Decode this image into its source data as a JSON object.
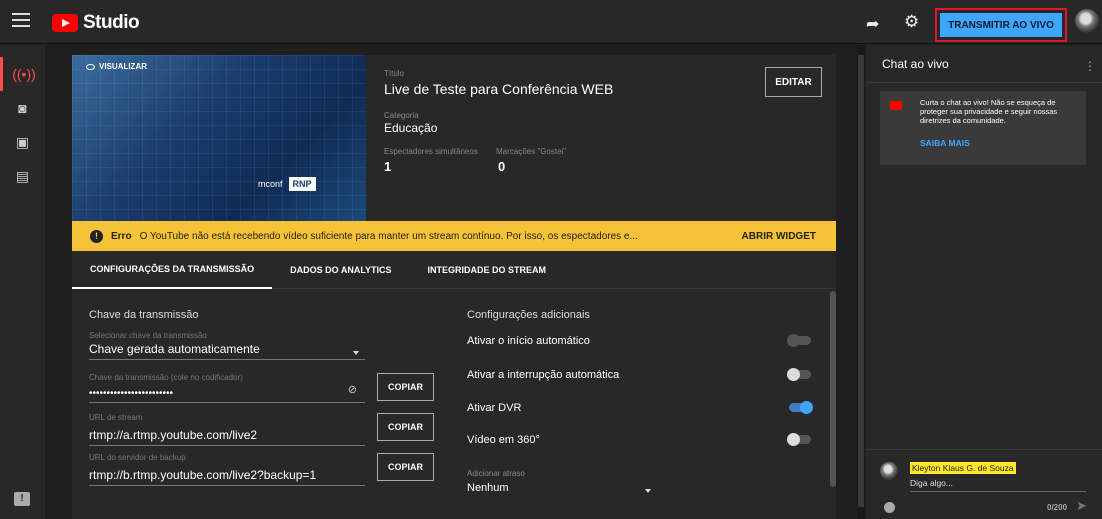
{
  "app": {
    "title": "Studio"
  },
  "header": {
    "live_button": "TRANSMITIR AO VIVO"
  },
  "preview": {
    "label": "VISUALIZAR",
    "logo_left": "mconf",
    "logo_right": "RNP"
  },
  "stream_info": {
    "title_label": "Título",
    "title_value": "Live de Teste para Conferência WEB",
    "category_label": "Categoria",
    "category_value": "Educação",
    "viewers_label": "Espectadores simultâneos",
    "viewers_value": "1",
    "likes_label": "Marcações \"Gostei\"",
    "likes_value": "0",
    "edit_button": "EDITAR"
  },
  "error": {
    "title": "Erro",
    "message": "O YouTube não está recebendo vídeo suficiente para manter um stream contínuo. Por isso, os espectadores e...",
    "action": "ABRIR WIDGET"
  },
  "tabs": [
    "CONFIGURAÇÕES DA TRANSMISSÃO",
    "DADOS DO ANALYTICS",
    "INTEGRIDADE DO STREAM"
  ],
  "stream_key": {
    "section_title": "Chave da transmissão",
    "select_label": "Selecionar chave da transmissão",
    "select_value": "Chave gerada automaticamente",
    "key_label": "Chave da transmissão (cole no codificador)",
    "key_value": "••••••••••••••••••••••••",
    "url_label": "URL de stream",
    "url_value": "rtmp://a.rtmp.youtube.com/live2",
    "backup_label": "URL do servidor de backup",
    "backup_value": "rtmp://b.rtmp.youtube.com/live2?backup=1",
    "copy_label": "COPIAR"
  },
  "additional": {
    "section_title": "Configurações adicionais",
    "toggles": [
      {
        "label": "Ativar o início automático",
        "state": "disabled"
      },
      {
        "label": "Ativar a interrupção automática",
        "state": "off"
      },
      {
        "label": "Ativar DVR",
        "state": "on"
      },
      {
        "label": "Vídeo em 360°",
        "state": "off"
      }
    ],
    "delay_label": "Adicionar atraso",
    "delay_value": "Nenhum"
  },
  "chat": {
    "title": "Chat ao vivo",
    "notice": "Curta o chat ao vivo! Não se esqueça de proteger sua privacidade e seguir nossas diretrizes da comunidade.",
    "notice_link": "SAIBA MAIS",
    "user_name": "Kleyton Klaus G. de Souza",
    "input_placeholder": "Diga algo...",
    "char_count": "0/200"
  }
}
